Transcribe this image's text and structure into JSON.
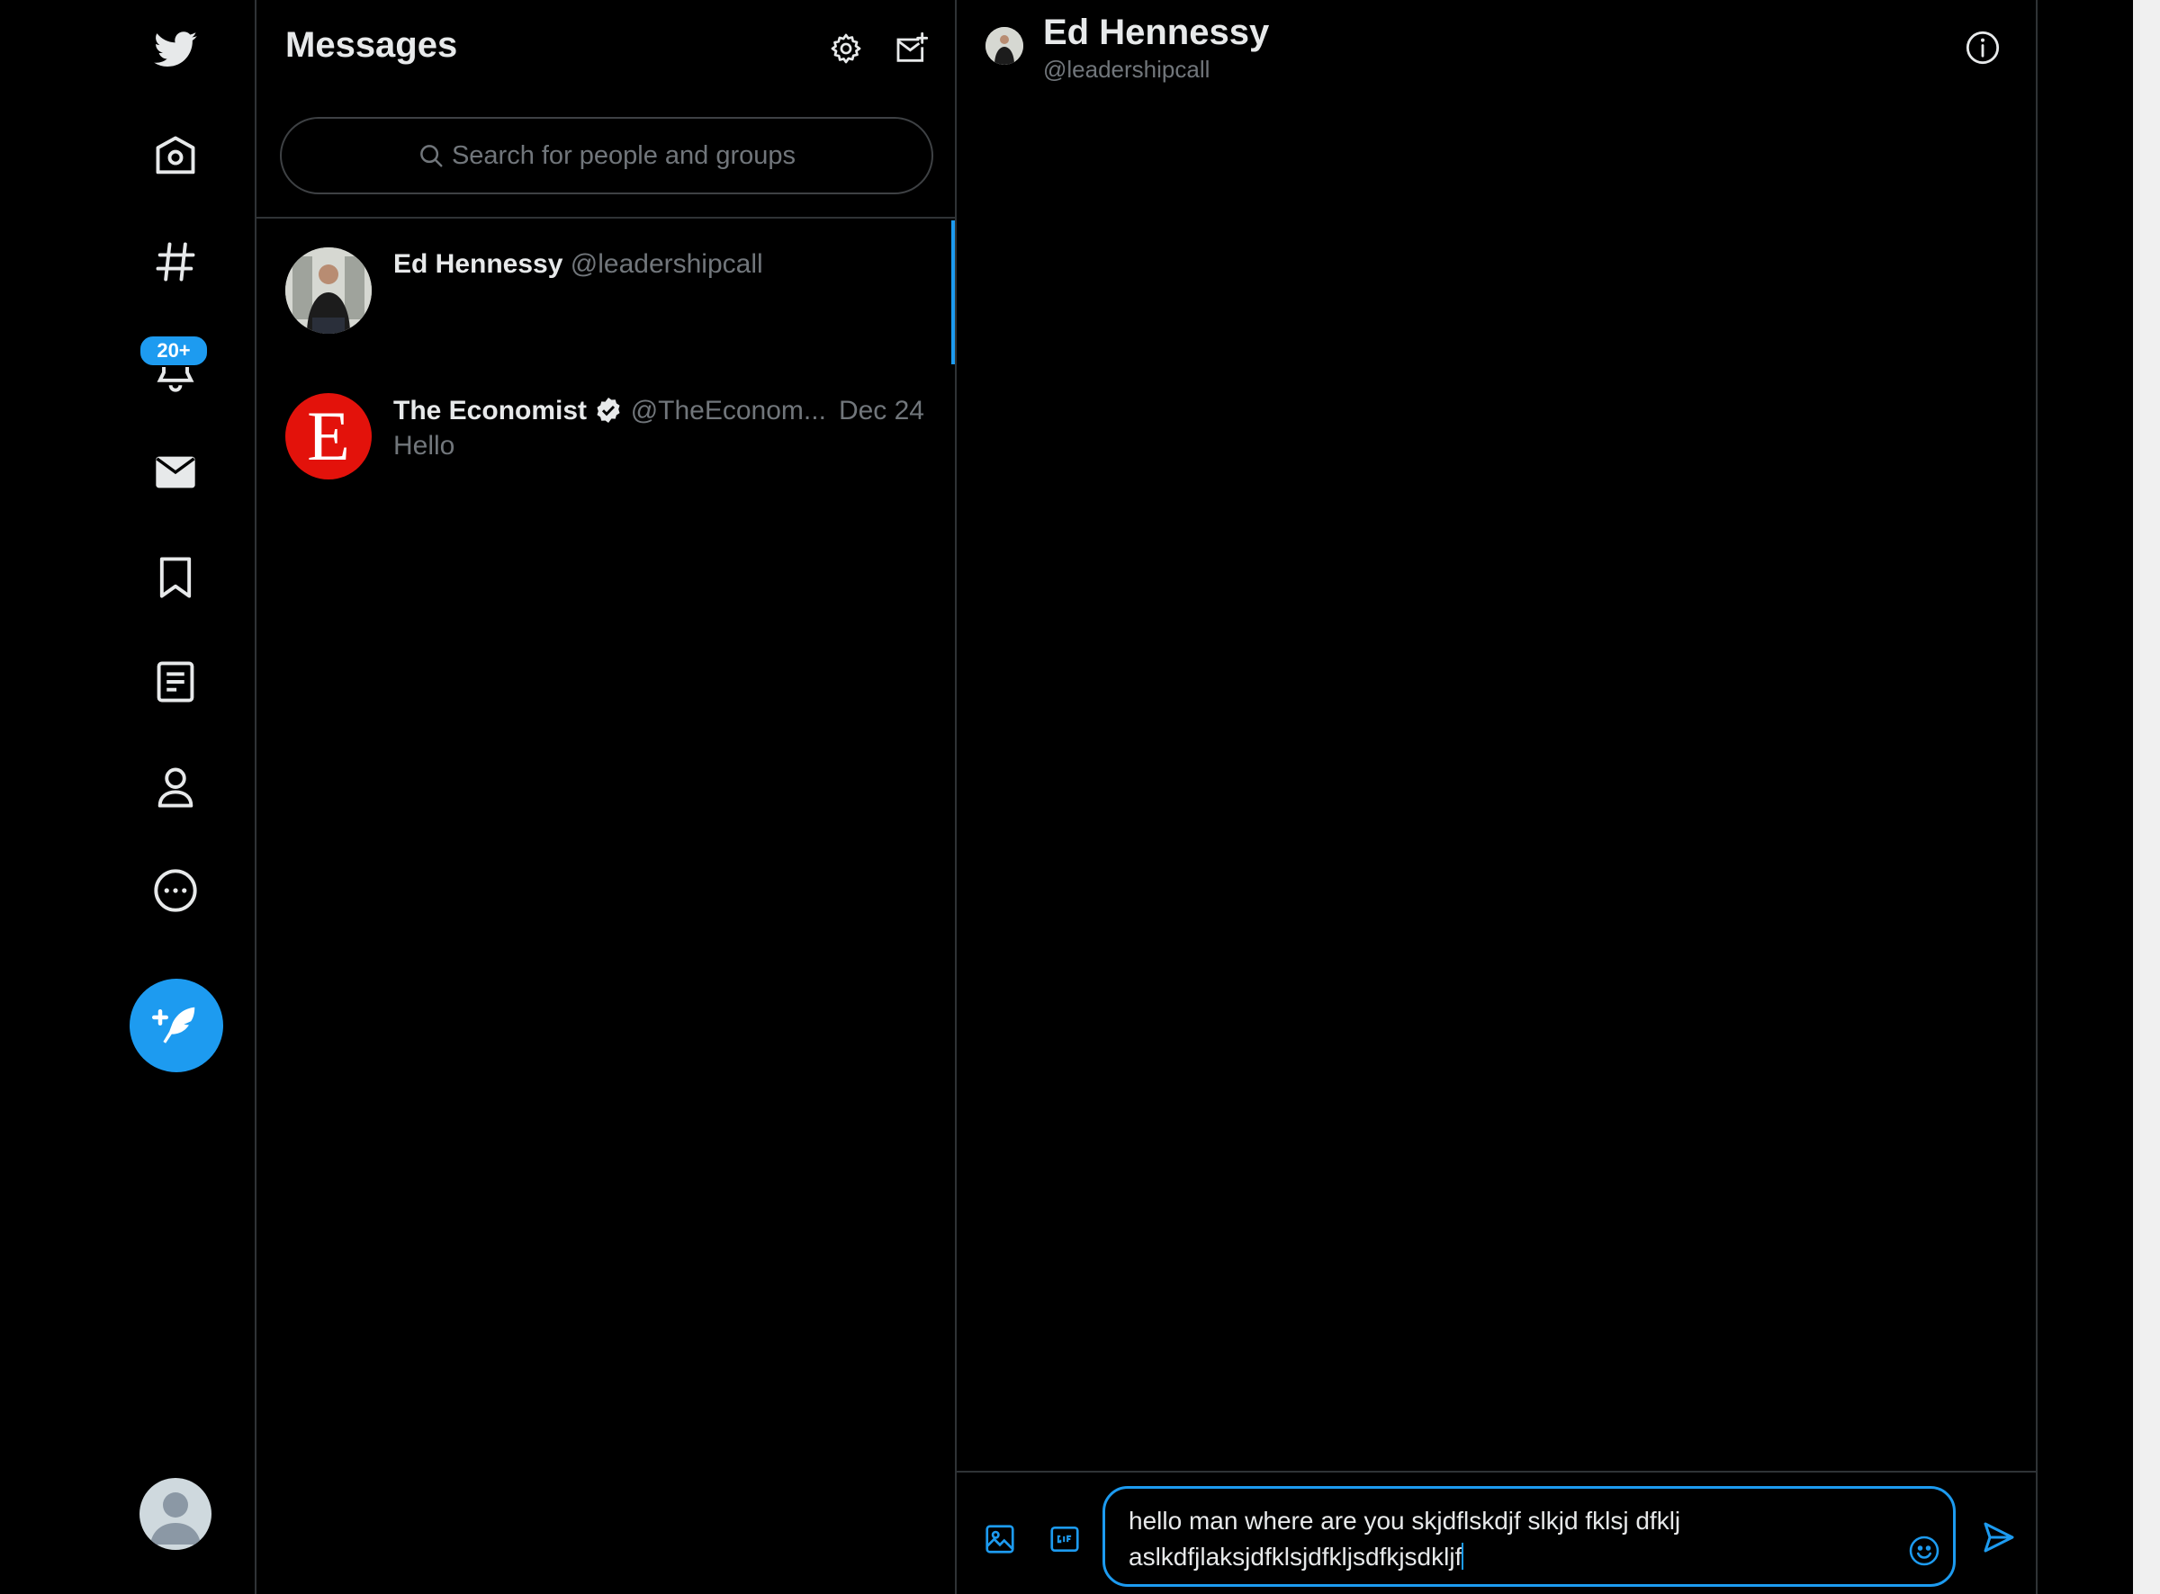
{
  "nav": {
    "badge_count": "20+",
    "items": [
      "twitter-logo",
      "home",
      "explore",
      "notifications",
      "messages",
      "bookmarks",
      "lists",
      "profile",
      "more"
    ],
    "compose_label": "Tweet"
  },
  "messages": {
    "title": "Messages",
    "search_placeholder": "Search for people and groups",
    "conversations": [
      {
        "name": "Ed Hennessy",
        "handle": "@leadershipcall",
        "date": "",
        "preview": "",
        "active": true
      },
      {
        "name": "The Economist",
        "handle": "@TheEconom...",
        "date": "Dec 24",
        "preview": "Hello",
        "verified": true,
        "avatar_letter": "E"
      }
    ]
  },
  "chat": {
    "name": "Ed Hennessy",
    "handle": "@leadershipcall",
    "draft_line1": "hello man where are you skjdflskdjf slkjd fklsj dfklj",
    "draft_line2": "aslkdfjlaksjdfklsjdfkljsdfkjsdkljf"
  },
  "colors": {
    "accent": "#1d9bf0",
    "background": "#000000",
    "economist_red": "#e3120b",
    "muted_text": "#71767b"
  }
}
